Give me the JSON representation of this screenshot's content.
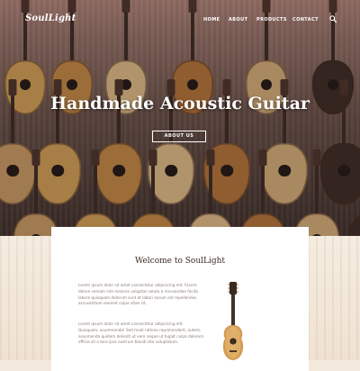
{
  "nav": {
    "logo": "SoulLight",
    "items": [
      "HOME",
      "ABOUT",
      "PRODUCTS",
      "CONTACT"
    ],
    "search_icon": "search-icon"
  },
  "hero": {
    "title": "Handmade Acoustic Guitar",
    "button_label": "ABOUT US"
  },
  "welcome": {
    "title": "Welcome to SoulLight",
    "paragraph_1": "Lorem ipsum dolor sit amet consectetur adipisicing elit. Facere dolore veniam iste maiores voluptas soluta a recusandae facilis labore quisquam dolorum sunt at labori earum est repellendus accusantium eveniet culpa vitae sit.",
    "paragraph_2": "Lorem ipsum dolor sit amet consectetur adipisicing elit. Quisquam, asummenda! Sed modi ratione reprehenderit, autem, assumenda quidem deleniti ut vero neque ut fugiat culpa dolorem officia sit a tora ipsa nostrum blandi iste voluptatum."
  },
  "colors": {
    "accent_text": "#3c2a22",
    "body_text": "#8a7c74",
    "card_bg": "#ffffff"
  }
}
